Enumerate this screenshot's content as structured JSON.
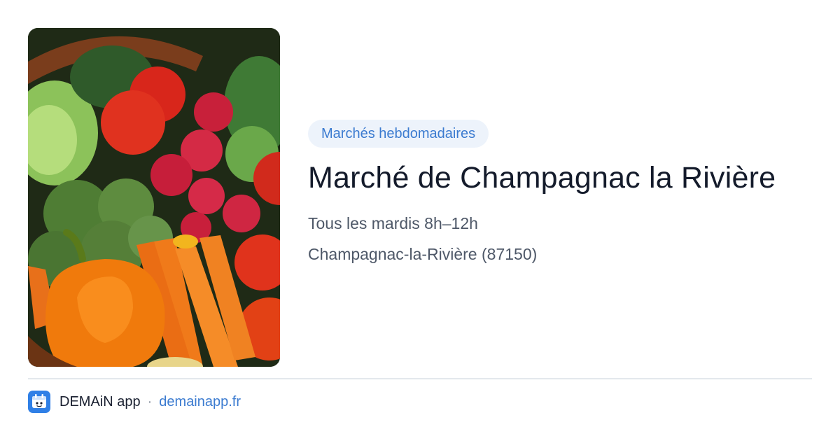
{
  "card": {
    "tag": "Marchés hebdomadaires",
    "title": "Marché de Champagnac la Rivière",
    "schedule": "Tous les mardis 8h–12h",
    "location": "Champagnac-la-Rivière (87150)"
  },
  "image": {
    "subject": "basket of fresh vegetables",
    "icon": "vegetables-photo"
  },
  "footer": {
    "brand": "DEMAiN app",
    "separator": "·",
    "domain": "demainapp.fr",
    "icon": "demain-app-icon"
  },
  "colors": {
    "accent": "#3b7bd0",
    "tag_background": "#edf3fb",
    "title": "#141b2b",
    "secondary_text": "#4e5868",
    "divider": "#e3e8ed",
    "app_icon": "#2f7fe6"
  }
}
